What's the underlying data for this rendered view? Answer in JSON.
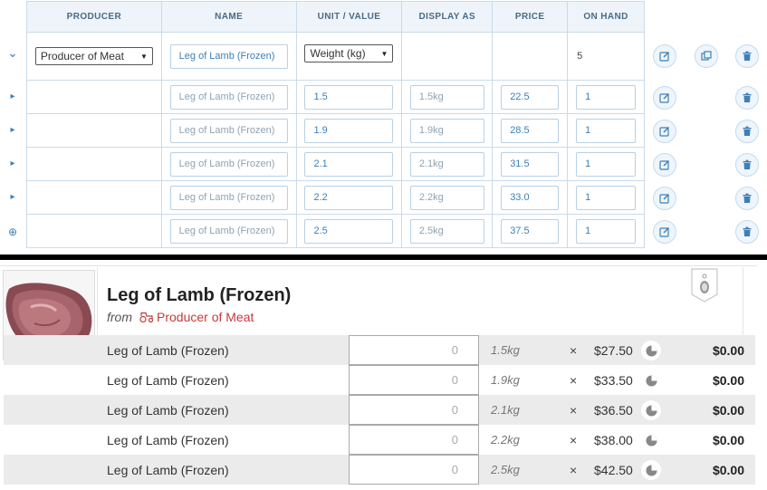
{
  "admin": {
    "headers": {
      "producer": "PRODUCER",
      "name": "NAME",
      "unit": "UNIT / VALUE",
      "display": "DISPLAY AS",
      "price": "PRICE",
      "on_hand": "ON HAND"
    },
    "parent": {
      "producer_select": "Producer of Meat",
      "name": "Leg of Lamb (Frozen)",
      "unit_select": "Weight (kg)",
      "on_hand": "5"
    },
    "variants": [
      {
        "name": "Leg of Lamb (Frozen)",
        "value": "1.5",
        "display": "1.5kg",
        "price": "22.5",
        "on_hand": "1"
      },
      {
        "name": "Leg of Lamb (Frozen)",
        "value": "1.9",
        "display": "1.9kg",
        "price": "28.5",
        "on_hand": "1"
      },
      {
        "name": "Leg of Lamb (Frozen)",
        "value": "2.1",
        "display": "2.1kg",
        "price": "31.5",
        "on_hand": "1"
      },
      {
        "name": "Leg of Lamb (Frozen)",
        "value": "2.2",
        "display": "2.2kg",
        "price": "33.0",
        "on_hand": "1"
      },
      {
        "name": "Leg of Lamb (Frozen)",
        "value": "2.5",
        "display": "2.5kg",
        "price": "37.5",
        "on_hand": "1"
      }
    ],
    "icons": {
      "expand": "chevron-down-icon",
      "row_expand": "triangle-right-icon",
      "add": "plus-circle-icon",
      "edit": "edit-icon",
      "clone": "clone-icon",
      "delete": "trash-icon"
    },
    "accent": "#3d7fb8"
  },
  "store": {
    "title": "Leg of Lamb (Frozen)",
    "from_label": "from",
    "producer": "Producer of Meat",
    "producer_color": "#c43a3a",
    "rows": [
      {
        "name": "Leg of Lamb (Frozen)",
        "qty": "0",
        "weight": "1.5kg",
        "times": "×",
        "price": "$27.50",
        "total": "$0.00"
      },
      {
        "name": "Leg of Lamb (Frozen)",
        "qty": "0",
        "weight": "1.9kg",
        "times": "×",
        "price": "$33.50",
        "total": "$0.00"
      },
      {
        "name": "Leg of Lamb (Frozen)",
        "qty": "0",
        "weight": "2.1kg",
        "times": "×",
        "price": "$36.50",
        "total": "$0.00"
      },
      {
        "name": "Leg of Lamb (Frozen)",
        "qty": "0",
        "weight": "2.2kg",
        "times": "×",
        "price": "$38.00",
        "total": "$0.00"
      },
      {
        "name": "Leg of Lamb (Frozen)",
        "qty": "0",
        "weight": "2.5kg",
        "times": "×",
        "price": "$42.50",
        "total": "$0.00"
      }
    ]
  }
}
